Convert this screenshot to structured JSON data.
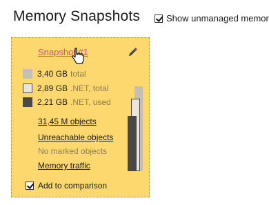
{
  "header": {
    "title": "Memory Snapshots",
    "show_unmanaged_label": "Show unmanaged memory",
    "show_unmanaged_checked": true
  },
  "snapshot": {
    "title": "Snapshot #1",
    "legend": [
      {
        "value": "3,40 GB",
        "kind": "total",
        "color": "#c4c0b8",
        "fraction": 1.0
      },
      {
        "value": "2,89 GB",
        "kind": ".NET, total",
        "color": "#eae6dc",
        "fraction": 0.85
      },
      {
        "value": "2,21 GB",
        "kind": ".NET, used",
        "color": "#4b4744",
        "fraction": 0.65
      }
    ],
    "objects_link": "31,45 M objects",
    "unreachable_link": "Unreachable objects",
    "no_marked": "No marked objects",
    "traffic_link": "Memory traffic",
    "add_comparison_label": "Add to comparison",
    "add_comparison_checked": true
  },
  "colors": {
    "card_background": "#fcd86f",
    "link_accent": "#c2567a"
  },
  "icons": [
    "pencil-icon",
    "hand-cursor-icon",
    "checkbox-checked-icon"
  ]
}
